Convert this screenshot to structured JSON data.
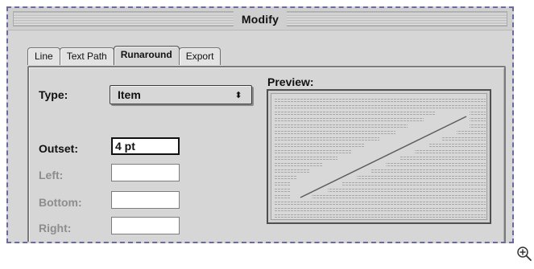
{
  "window": {
    "title": "Modify"
  },
  "tabs": [
    {
      "label": "Line",
      "active": false
    },
    {
      "label": "Text Path",
      "active": false
    },
    {
      "label": "Runaround",
      "active": true
    },
    {
      "label": "Export",
      "active": false
    }
  ],
  "form": {
    "type_label": "Type:",
    "type_value": "Item",
    "outset_label": "Outset:",
    "outset_value": "4  pt",
    "left_label": "Left:",
    "bottom_label": "Bottom:",
    "right_label": "Right:"
  },
  "preview": {
    "label": "Preview:"
  },
  "icons": {
    "zoom": "zoom-in-icon",
    "popup_arrow": "up-down-arrow-icon"
  },
  "colors": {
    "dialog_bg": "#d6d6d6",
    "selection_outline": "#6a6aa0",
    "text": "#111111",
    "disabled_text": "#8d8d8d"
  }
}
